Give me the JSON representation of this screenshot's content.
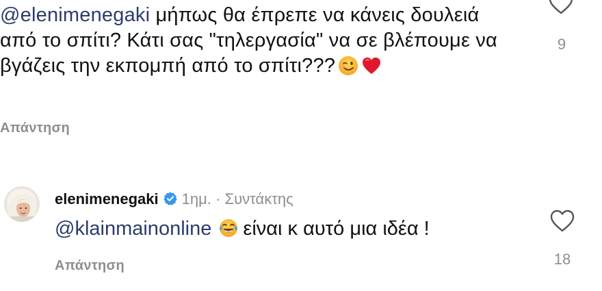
{
  "comment1": {
    "mention": "@elenimenegaki",
    "text": " μήπως θα έπρεπε να κάνεις δουλειά από το σπίτι? Κάτι σας \"τηλεργασία\" να σε βλέπουμε να βγάζεις την εκπομπή από το σπίτι???",
    "emojis": [
      "winking-face-emoji",
      "red-heart-emoji"
    ],
    "reply_label": "Απάντηση",
    "likes": "9"
  },
  "comment2": {
    "username": "elenimenegaki",
    "time": "1ημ.",
    "separator": "·",
    "role": "Συντάκτης",
    "mention": "@klainmainonline",
    "text": "είναι κ αυτό μια ιδέα !",
    "emoji": "tears-of-joy-emoji",
    "reply_label": "Απάντηση",
    "likes": "18"
  },
  "icons": {
    "like": "heart-outline-icon",
    "verified": "verified-badge-icon"
  },
  "colors": {
    "mention": "#2a3d6b",
    "muted": "#8e8e8e",
    "verified": "#3897f0",
    "text": "#111111"
  }
}
